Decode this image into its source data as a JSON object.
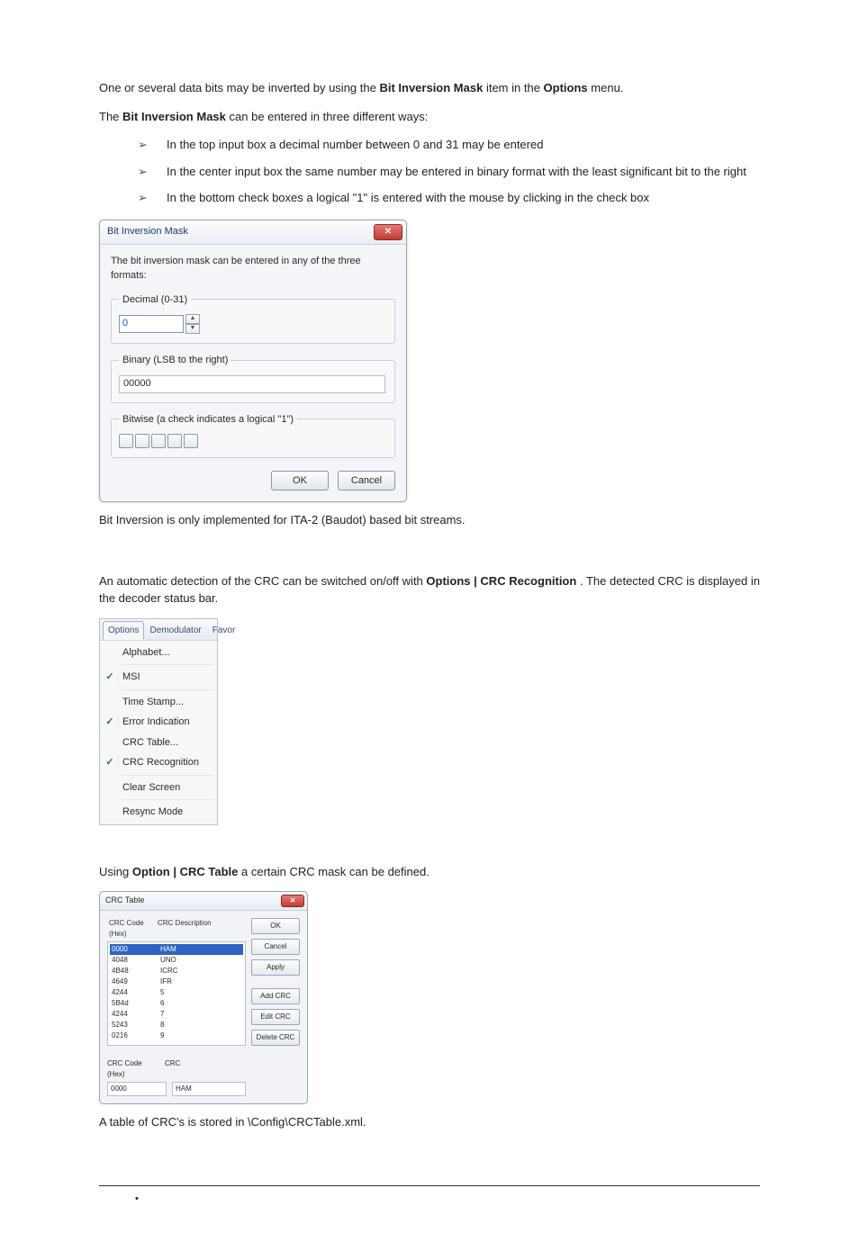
{
  "para1_a": "One or several data bits may be inverted by using the ",
  "para1_b": "Bit Inversion Mask",
  "para1_c": " item in the ",
  "para1_d": "Options",
  "para1_e": " menu.",
  "para2_a": "The ",
  "para2_b": "Bit Inversion Mask",
  "para2_c": " can be entered in three different ways:",
  "bullets": {
    "0": "In the top input box a decimal number between 0 and 31 may be entered",
    "1": "In the center input box the same number may be entered in binary format with the least significant bit to the right",
    "2": "In the bottom check boxes a logical \"1\" is entered with the mouse by clicking in the check box"
  },
  "dlg1": {
    "title": "Bit Inversion Mask",
    "instruction": "The bit inversion mask can be entered in any of the three formats:",
    "legend_dec": "Decimal (0-31)",
    "dec_value": "0",
    "legend_bin": "Binary (LSB to the right)",
    "bin_value": "00000",
    "legend_bit": "Bitwise (a check indicates a logical \"1\")",
    "ok": "OK",
    "cancel": "Cancel"
  },
  "para3": "Bit Inversion is only implemented for ITA-2 (Baudot) based bit streams.",
  "para4_a": "An automatic detection of the CRC can be switched on/off with ",
  "para4_b": "Options | CRC Recognition",
  "para4_c": ". The detected CRC is displayed in the decoder status bar.",
  "menu": {
    "tabs": {
      "0": "Options",
      "1": "Demodulator",
      "2": "Favor"
    },
    "items": {
      "0": "Alphabet...",
      "1": "MSI",
      "2": "Time Stamp...",
      "3": "Error Indication",
      "4": "CRC Table...",
      "5": "CRC Recognition",
      "6": "Clear Screen",
      "7": "Resync Mode"
    }
  },
  "para5_a": "Using ",
  "para5_b": "Option | CRC Table",
  "para5_c": " a certain CRC mask can be defined.",
  "crc": {
    "title": "CRC Table",
    "head_code": "CRC Code (Hex)",
    "head_desc": "CRC Description",
    "rows": {
      "0": {
        "code": "0000",
        "desc": "HAM"
      },
      "1": {
        "code": "4048",
        "desc": "UNO"
      },
      "2": {
        "code": "4B48",
        "desc": "ICRC"
      },
      "3": {
        "code": "4649",
        "desc": "IFR"
      },
      "4": {
        "code": "4244",
        "desc": "5"
      },
      "5": {
        "code": "5B4d",
        "desc": "6"
      },
      "6": {
        "code": "4244",
        "desc": "7"
      },
      "7": {
        "code": "5243",
        "desc": "8"
      },
      "8": {
        "code": "0216",
        "desc": "9"
      }
    },
    "ok": "OK",
    "cancel": "Cancel",
    "apply": "Apply",
    "label_code": "CRC Code (Hex)",
    "label_crc": "CRC",
    "field_code": "0000",
    "field_crc": "HAM",
    "add": "Add CRC",
    "edit": "Edit CRC",
    "del": "Delete CRC"
  },
  "para6": "A table of CRC's is stored in \\Config\\CRCTable.xml.",
  "bullet_footer": "•"
}
